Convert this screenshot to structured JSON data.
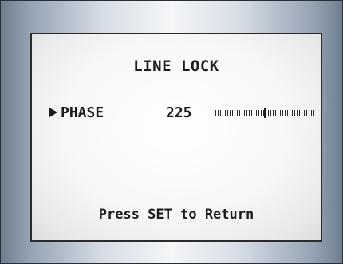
{
  "menu": {
    "title": "LINE LOCK",
    "items": [
      {
        "cursor_icon": "right-triangle-icon",
        "label": "PHASE",
        "value": "225",
        "slider_level": 0.49
      }
    ],
    "footer": "Press SET to Return"
  },
  "colors": {
    "text": "#1c1c1c",
    "screen": "#f4f4f4",
    "bezel_edge": "#6f7e90"
  }
}
